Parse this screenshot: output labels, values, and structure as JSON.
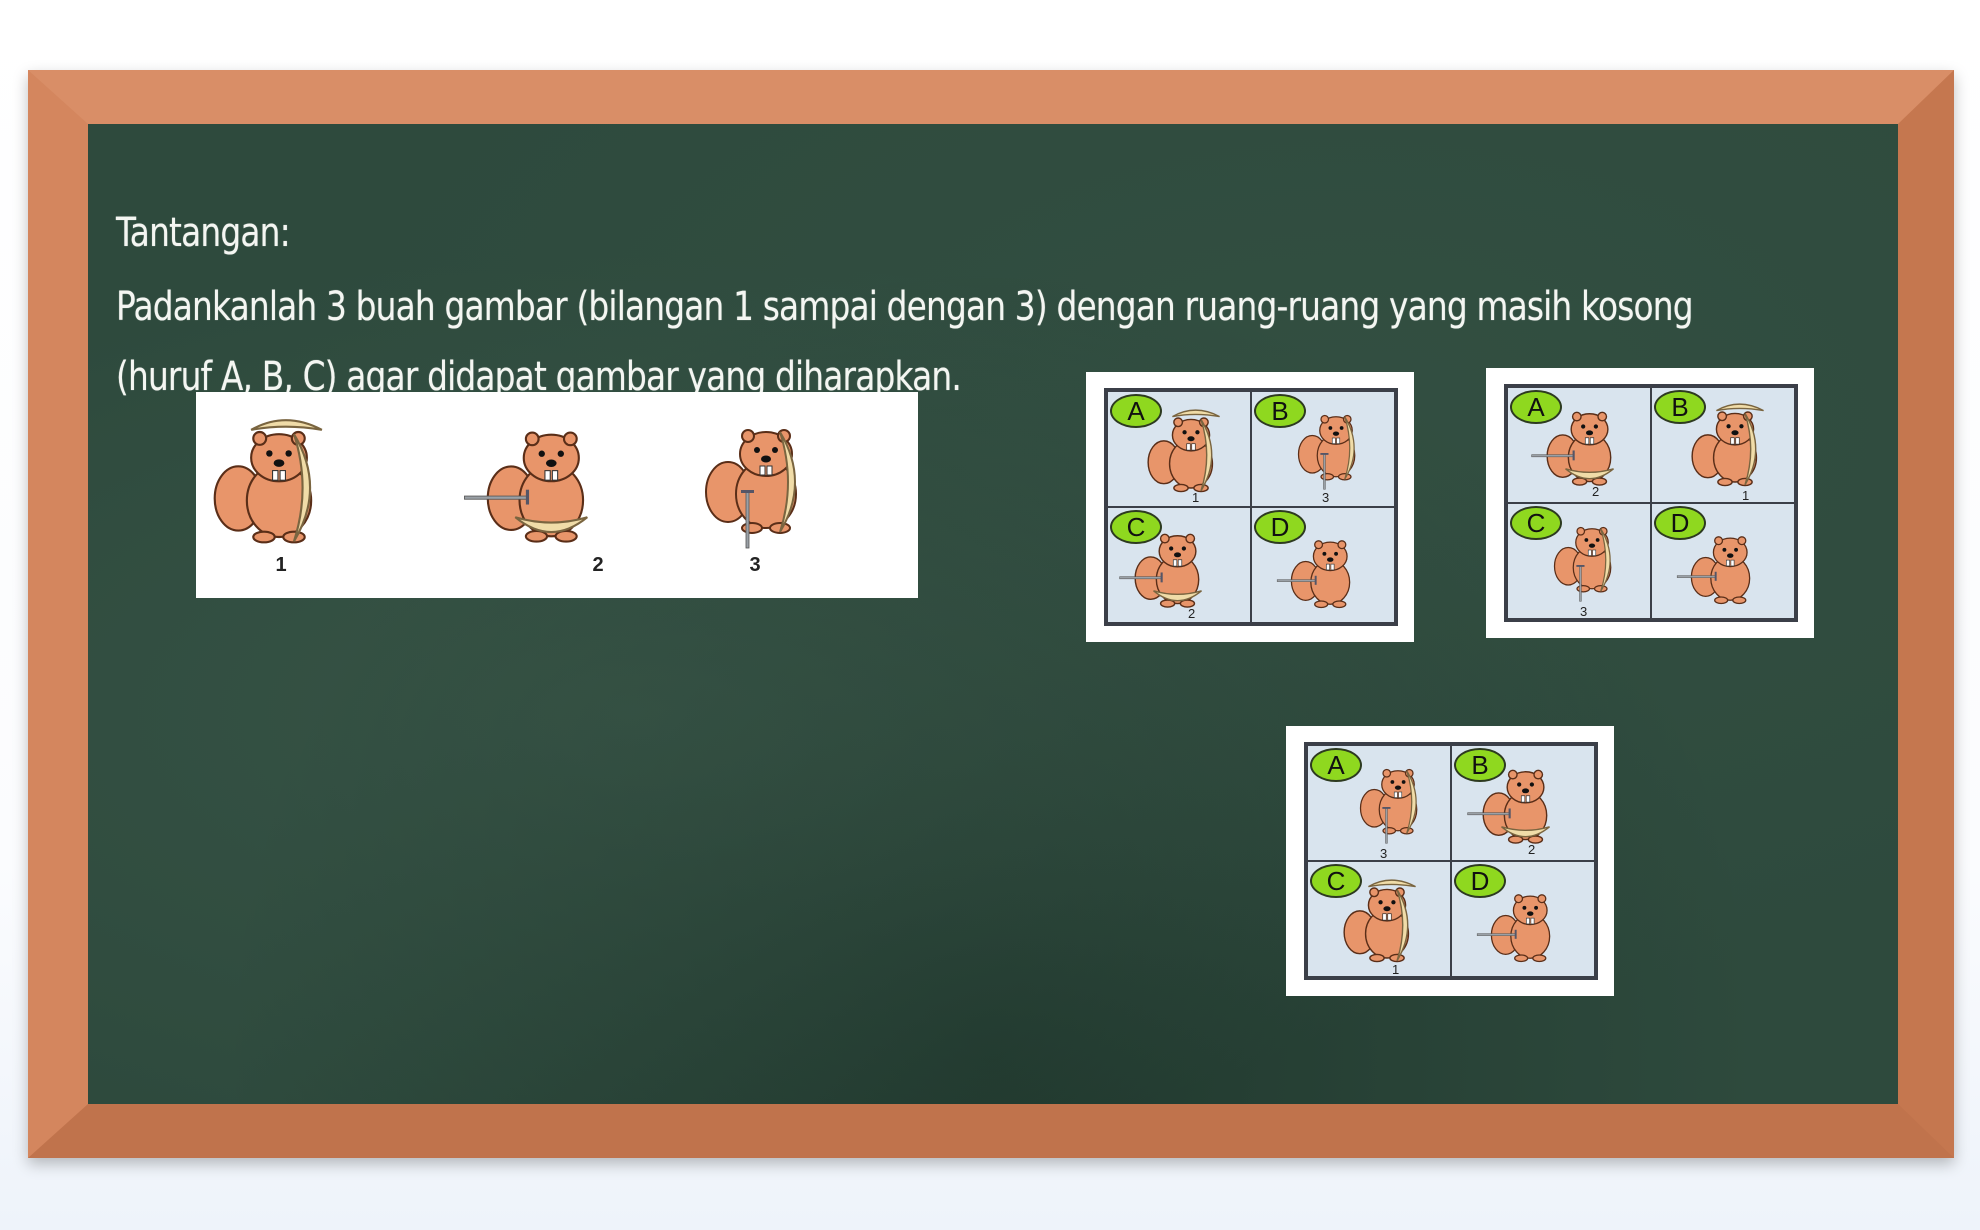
{
  "board": {
    "heading": "Tantangan:",
    "line1": "Padankanlah 3 buah gambar (bilangan 1 sampai dengan 3) dengan ruang-ruang yang masih kosong",
    "line2": "(huruf A, B, C) agar didapat gambar yang diharapkan."
  },
  "pieces": [
    {
      "number": "1",
      "icon": "beaver-with-shield-icon"
    },
    {
      "number": "2",
      "icon": "beaver-with-sword-and-shield-icon"
    },
    {
      "number": "3",
      "icon": "beaver-with-sword-icon"
    }
  ],
  "options": [
    {
      "cells": [
        {
          "letter": "A",
          "number": "1"
        },
        {
          "letter": "B",
          "number": "3"
        },
        {
          "letter": "C",
          "number": "2"
        },
        {
          "letter": "D",
          "number": ""
        }
      ]
    },
    {
      "cells": [
        {
          "letter": "A",
          "number": "2"
        },
        {
          "letter": "B",
          "number": "1"
        },
        {
          "letter": "C",
          "number": "3"
        },
        {
          "letter": "D",
          "number": ""
        }
      ]
    },
    {
      "cells": [
        {
          "letter": "A",
          "number": "3"
        },
        {
          "letter": "B",
          "number": "2"
        },
        {
          "letter": "C",
          "number": "1"
        },
        {
          "letter": "D",
          "number": ""
        }
      ]
    }
  ],
  "colors": {
    "frame": "#d4865e",
    "chalkboard": "#2e4a3d",
    "chalk": "#f4f6f2",
    "beaver": "#e8956a",
    "shield": "#f0dca8",
    "badge": "#8fd81f",
    "cell": "#d9e4ee"
  }
}
